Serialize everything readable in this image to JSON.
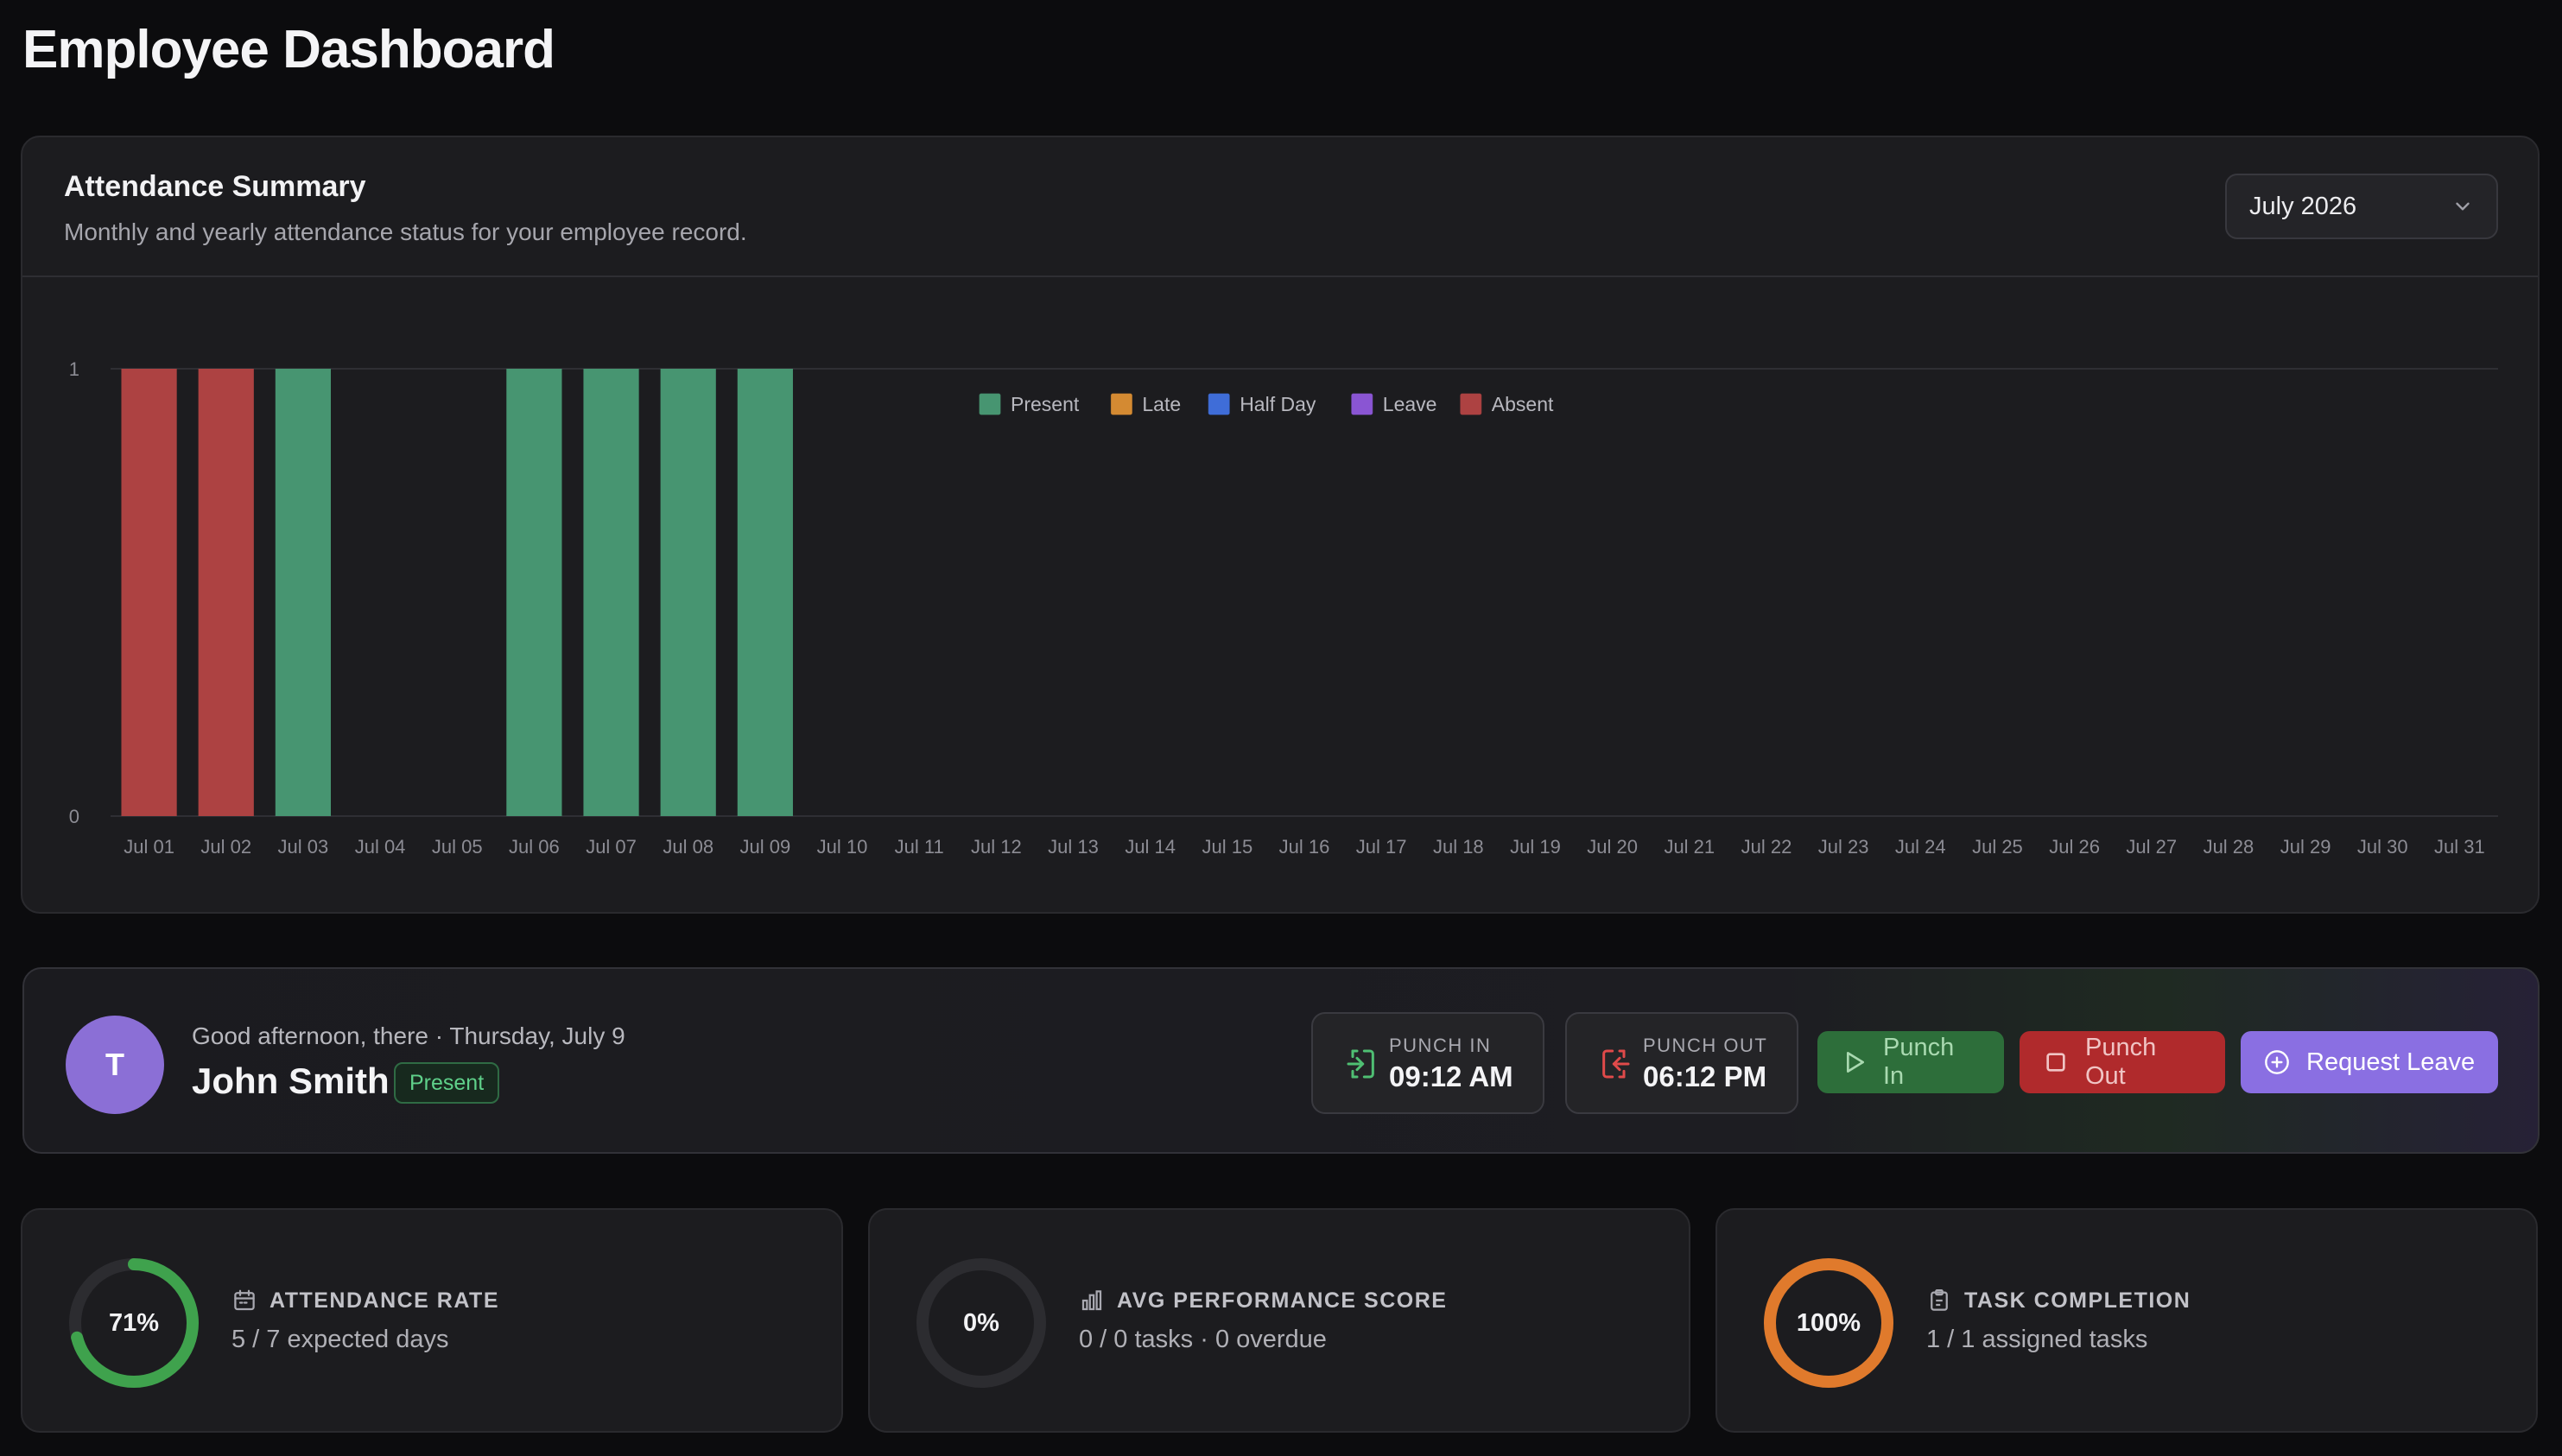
{
  "page": {
    "title": "Employee Dashboard"
  },
  "attendance_summary": {
    "title": "Attendance Summary",
    "subtitle": "Monthly and yearly attendance status for your employee record.",
    "month_select": {
      "value": "July 2026"
    }
  },
  "colors": {
    "present": "#479571",
    "late": "#d48a32",
    "half_day": "#3f6dd8",
    "leave": "#8a55d3",
    "absent": "#ad4242"
  },
  "chart_data": {
    "type": "bar",
    "legend_position": "top-center",
    "grid": true,
    "ylim": [
      0,
      1
    ],
    "yticks": [
      0,
      1
    ],
    "categories": [
      "Jul 01",
      "Jul 02",
      "Jul 03",
      "Jul 04",
      "Jul 05",
      "Jul 06",
      "Jul 07",
      "Jul 08",
      "Jul 09",
      "Jul 10",
      "Jul 11",
      "Jul 12",
      "Jul 13",
      "Jul 14",
      "Jul 15",
      "Jul 16",
      "Jul 17",
      "Jul 18",
      "Jul 19",
      "Jul 20",
      "Jul 21",
      "Jul 22",
      "Jul 23",
      "Jul 24",
      "Jul 25",
      "Jul 26",
      "Jul 27",
      "Jul 28",
      "Jul 29",
      "Jul 30",
      "Jul 31"
    ],
    "series": [
      {
        "name": "Present",
        "color_key": "present",
        "values": [
          0,
          0,
          1,
          0,
          0,
          1,
          1,
          1,
          1,
          0,
          0,
          0,
          0,
          0,
          0,
          0,
          0,
          0,
          0,
          0,
          0,
          0,
          0,
          0,
          0,
          0,
          0,
          0,
          0,
          0,
          0
        ]
      },
      {
        "name": "Late",
        "color_key": "late",
        "values": [
          0,
          0,
          0,
          0,
          0,
          0,
          0,
          0,
          0,
          0,
          0,
          0,
          0,
          0,
          0,
          0,
          0,
          0,
          0,
          0,
          0,
          0,
          0,
          0,
          0,
          0,
          0,
          0,
          0,
          0,
          0
        ]
      },
      {
        "name": "Half Day",
        "color_key": "half_day",
        "values": [
          0,
          0,
          0,
          0,
          0,
          0,
          0,
          0,
          0,
          0,
          0,
          0,
          0,
          0,
          0,
          0,
          0,
          0,
          0,
          0,
          0,
          0,
          0,
          0,
          0,
          0,
          0,
          0,
          0,
          0,
          0
        ]
      },
      {
        "name": "Leave",
        "color_key": "leave",
        "values": [
          0,
          0,
          0,
          0,
          0,
          0,
          0,
          0,
          0,
          0,
          0,
          0,
          0,
          0,
          0,
          0,
          0,
          0,
          0,
          0,
          0,
          0,
          0,
          0,
          0,
          0,
          0,
          0,
          0,
          0,
          0
        ]
      },
      {
        "name": "Absent",
        "color_key": "absent",
        "values": [
          1,
          1,
          0,
          0,
          0,
          0,
          0,
          0,
          0,
          0,
          0,
          0,
          0,
          0,
          0,
          0,
          0,
          0,
          0,
          0,
          0,
          0,
          0,
          0,
          0,
          0,
          0,
          0,
          0,
          0,
          0
        ]
      }
    ]
  },
  "greeting": {
    "avatar_initial": "T",
    "message": "Good afternoon, there · Thursday, July 9",
    "name": "John Smith",
    "status": "Present",
    "punch_in": {
      "label": "PUNCH IN",
      "time": "09:12 AM"
    },
    "punch_out": {
      "label": "PUNCH OUT",
      "time": "06:12 PM"
    },
    "buttons": {
      "punch_in": "Punch In",
      "punch_out": "Punch Out",
      "request_leave": "Request Leave"
    }
  },
  "stats": {
    "attendance": {
      "label": "ATTENDANCE RATE",
      "value": "71%",
      "fraction": 0.71,
      "sub": "5 / 7 expected days",
      "color": "#3fa24d",
      "icon": "calendar-icon"
    },
    "performance": {
      "label": "AVG PERFORMANCE SCORE",
      "value": "0%",
      "fraction": 0,
      "sub": "0 / 0 tasks · 0 overdue",
      "color": "#3fa24d",
      "icon": "bar-chart-icon"
    },
    "tasks": {
      "label": "TASK COMPLETION",
      "value": "100%",
      "fraction": 1,
      "sub": "1 / 1 assigned tasks",
      "color": "#e07a2c",
      "icon": "clipboard-icon"
    }
  }
}
